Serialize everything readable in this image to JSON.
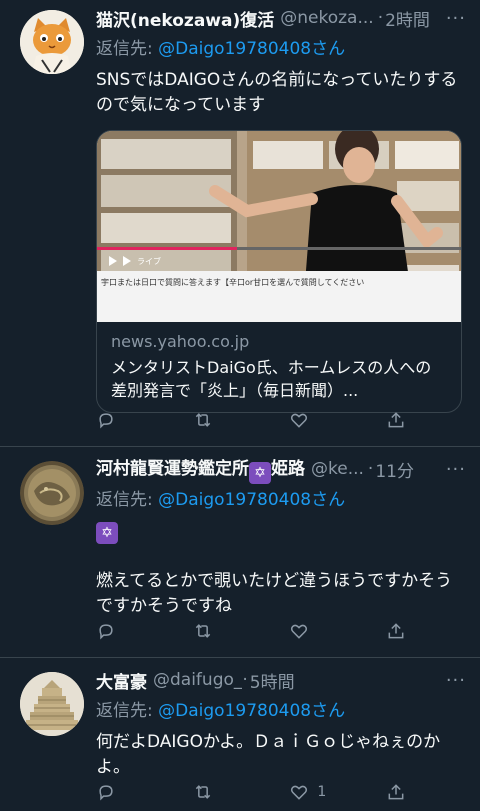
{
  "colors": {
    "background": "#15202b",
    "link": "#1d9bf0",
    "muted": "#8b98a5",
    "divider": "#38444d"
  },
  "tweets": [
    {
      "name": "猫沢(nekozawa)復活",
      "handle": "@nekoza...",
      "dot": "·",
      "time": "2時間",
      "more": "···",
      "reply_prefix": "返信先: ",
      "reply_to": "@Daigo19780408さん",
      "text": "SNSではDAIGOさんの名前になっていたりするので気になっています",
      "card": {
        "domain": "news.yahoo.co.jp",
        "title": "メンタリストDaiGo氏、ホームレスの人への差別発言で「炎上」（毎日新聞）...",
        "caption": "宇口または日口で質問に答えます【辛口or甘口を選んで質問してください",
        "live": "ライブ"
      },
      "actions": {
        "reply": "",
        "retweet": "",
        "like": "",
        "share": ""
      }
    },
    {
      "name": "河村龍賢運勢鑑定所",
      "name_suffix": "姫路",
      "badge": "✡",
      "handle": "@ke...",
      "dot": "·",
      "time": "11分",
      "more": "···",
      "reply_prefix": "返信先: ",
      "reply_to": "@Daigo19780408さん",
      "emoji": "✡",
      "text": "燃えてるとかで覗いたけど違うほうですかそうですかそうですね",
      "actions": {
        "reply": "",
        "retweet": "",
        "like": "",
        "share": ""
      }
    },
    {
      "name": "大富豪",
      "handle": "@daifugo_",
      "dot": "·",
      "time": "5時間",
      "more": "···",
      "reply_prefix": "返信先: ",
      "reply_to": "@Daigo19780408さん",
      "text": "何だよDAIGOかよ。ＤａｉＧｏじゃねぇのかよ。",
      "actions": {
        "reply": "",
        "retweet": "",
        "like": "1",
        "share": ""
      }
    }
  ]
}
